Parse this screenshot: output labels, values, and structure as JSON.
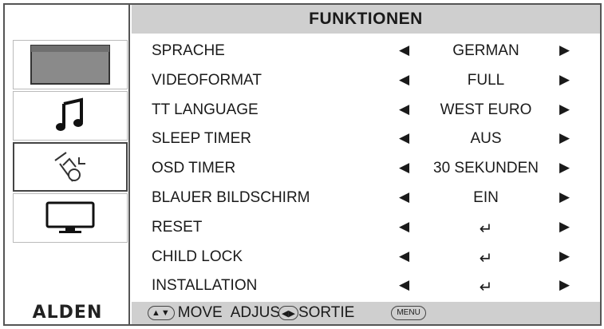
{
  "header": {
    "title": "FUNKTIONEN"
  },
  "sidebar": {
    "tabs": [
      {
        "name": "picture-icon"
      },
      {
        "name": "music-note-icon"
      },
      {
        "name": "setup-tools-icon",
        "active": true
      },
      {
        "name": "monitor-icon"
      }
    ],
    "logo": "ALDEN"
  },
  "menu": {
    "rows": [
      {
        "label": "SPRACHE",
        "value": "GERMAN"
      },
      {
        "label": "VIDEOFORMAT",
        "value": "FULL"
      },
      {
        "label": "TT LANGUAGE",
        "value": "WEST EURO"
      },
      {
        "label": "SLEEP TIMER",
        "value": "AUS"
      },
      {
        "label": "OSD TIMER",
        "value": "30 SEKUNDEN"
      },
      {
        "label": "BLAUER BILDSCHIRM",
        "value": "EIN"
      },
      {
        "label": "RESET",
        "value": "↵"
      },
      {
        "label": "CHILD LOCK",
        "value": "↵"
      },
      {
        "label": "INSTALLATION",
        "value": "↵"
      }
    ],
    "arrow_left": "◀",
    "arrow_right": "▶"
  },
  "footer": {
    "nav_keys": "▲▼",
    "move": "MOVE",
    "adjust": "ADJUS",
    "lr_keys": "◀▶",
    "exit": "SORTIE",
    "menu_key": "MENU"
  },
  "colors": {
    "header_bg": "#cfcfcf",
    "border": "#555555",
    "text": "#1a1a1a"
  }
}
